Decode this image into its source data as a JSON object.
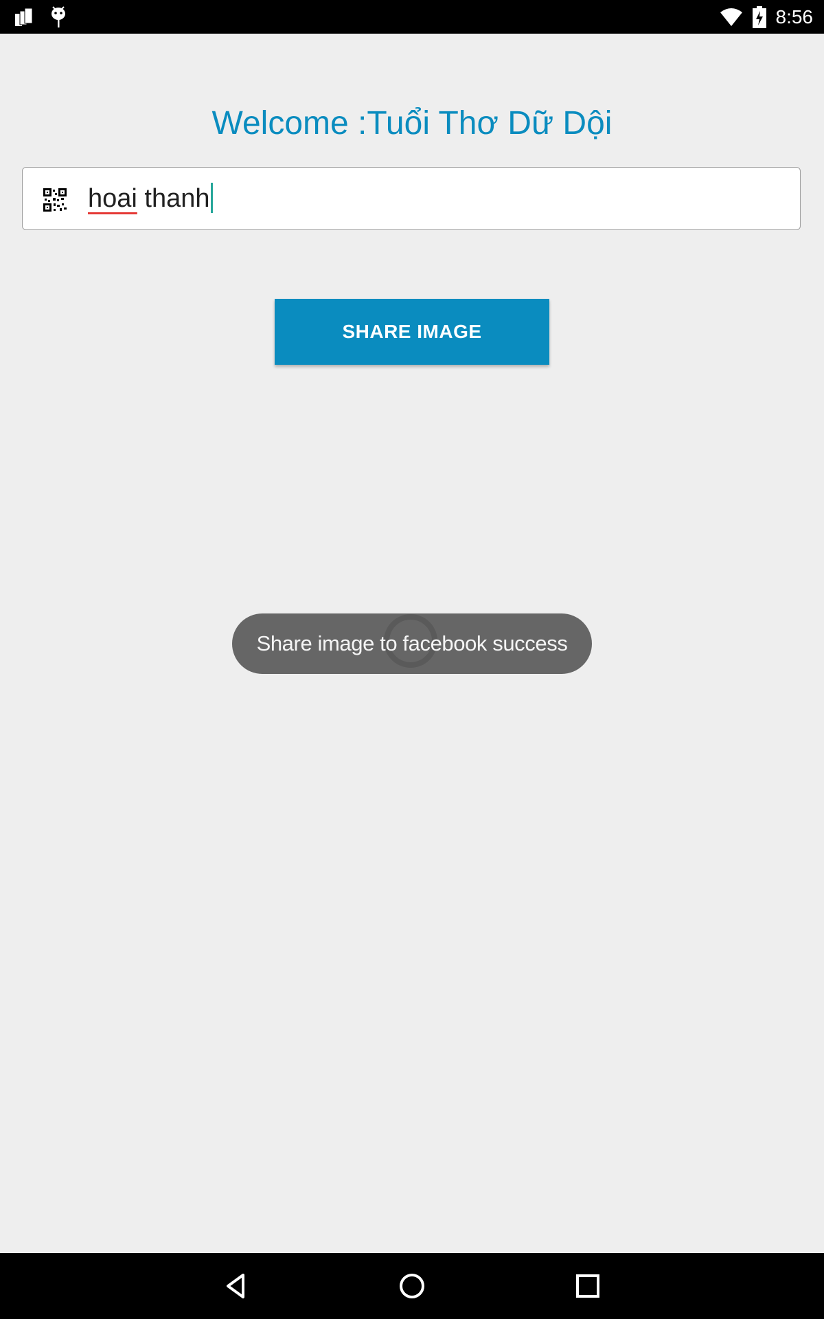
{
  "status_bar": {
    "time": "8:56",
    "icons": [
      "notification-stack-icon",
      "android-debug-icon",
      "wifi-icon",
      "battery-charging-icon"
    ]
  },
  "main": {
    "title": "Welcome :Tuổi Thơ Dữ Dội",
    "input": {
      "value_word1": "hoai",
      "value_word2": " thanh",
      "icon": "qr-code-icon"
    },
    "share_button_label": "SHARE IMAGE"
  },
  "toast": {
    "message": "Share image to facebook success"
  },
  "nav_bar": {
    "icons": [
      "back-icon",
      "home-icon",
      "recents-icon"
    ]
  },
  "colors": {
    "accent": "#0a8cbf",
    "background": "#eeeeee",
    "toast_bg": "#666666"
  }
}
